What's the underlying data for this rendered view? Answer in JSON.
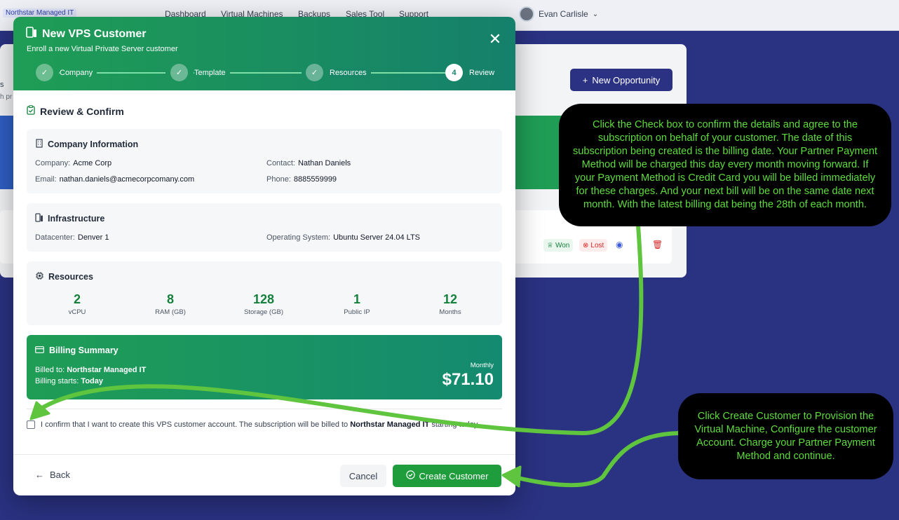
{
  "nav": {
    "brand": "Northstar Managed IT",
    "links": [
      "Dashboard",
      "Virtual Machines",
      "Backups",
      "Sales Tool",
      "Support"
    ],
    "user_name": "Evan Carlisle"
  },
  "background_page": {
    "frag1": "s",
    "frag2": "h pr",
    "new_opportunity_label": "New Opportunity",
    "won_label": "Won",
    "lost_label": "Lost"
  },
  "modal": {
    "title": "New VPS Customer",
    "subtitle": "Enroll a new Virtual Private Server customer",
    "steps": [
      {
        "label": "Company",
        "marker": "✓"
      },
      {
        "label": "Template",
        "marker": "✓"
      },
      {
        "label": "Resources",
        "marker": "✓"
      },
      {
        "label": "Review",
        "marker": "4"
      }
    ],
    "section_title": "Review & Confirm",
    "company": {
      "title": "Company Information",
      "company_label": "Company:",
      "company_value": "Acme Corp",
      "contact_label": "Contact:",
      "contact_value": "Nathan Daniels",
      "email_label": "Email:",
      "email_value": "nathan.daniels@acmecorpcomany.com",
      "phone_label": "Phone:",
      "phone_value": "8885559999"
    },
    "infrastructure": {
      "title": "Infrastructure",
      "datacenter_label": "Datacenter:",
      "datacenter_value": "Denver 1",
      "os_label": "Operating System:",
      "os_value": "Ubuntu Server 24.04 LTS"
    },
    "resources": {
      "title": "Resources",
      "items": [
        {
          "value": "2",
          "label": "vCPU"
        },
        {
          "value": "8",
          "label": "RAM (GB)"
        },
        {
          "value": "128",
          "label": "Storage (GB)"
        },
        {
          "value": "1",
          "label": "Public IP"
        },
        {
          "value": "12",
          "label": "Months"
        }
      ]
    },
    "billing": {
      "title": "Billing Summary",
      "billed_to_label": "Billed to:",
      "billed_to_value": "Northstar Managed IT",
      "starts_label": "Billing starts:",
      "starts_value": "Today",
      "frequency": "Monthly",
      "amount": "$71.10"
    },
    "confirm": {
      "text_before": "I confirm that I want to create this VPS customer account. The subscription will be billed to",
      "company": "Northstar Managed IT",
      "text_after": "starting today."
    },
    "footer": {
      "back_label": "Back",
      "cancel_label": "Cancel",
      "create_label": "Create Customer"
    }
  },
  "callouts": {
    "checkbox_note": "Click the Check box to confirm the details and agree to the subscription on behalf of your customer. The date of this subscription being created is the billing date. Your Partner Payment Method will be charged this day every month moving forward. If your Payment Method is Credit Card you will be billed immediately for these charges. And your next bill will be on the same date next month. With the latest billing dat being the 28th of each month.",
    "create_note": "Click Create Customer to Provision the Virtual Machine, Configure the customer Account. Charge your Partner Payment Method and continue."
  },
  "colors": {
    "accent_green": "#1f9d55",
    "teal": "#15806b",
    "page_bg": "#2a3282",
    "callout_text": "#5fdc3e"
  }
}
